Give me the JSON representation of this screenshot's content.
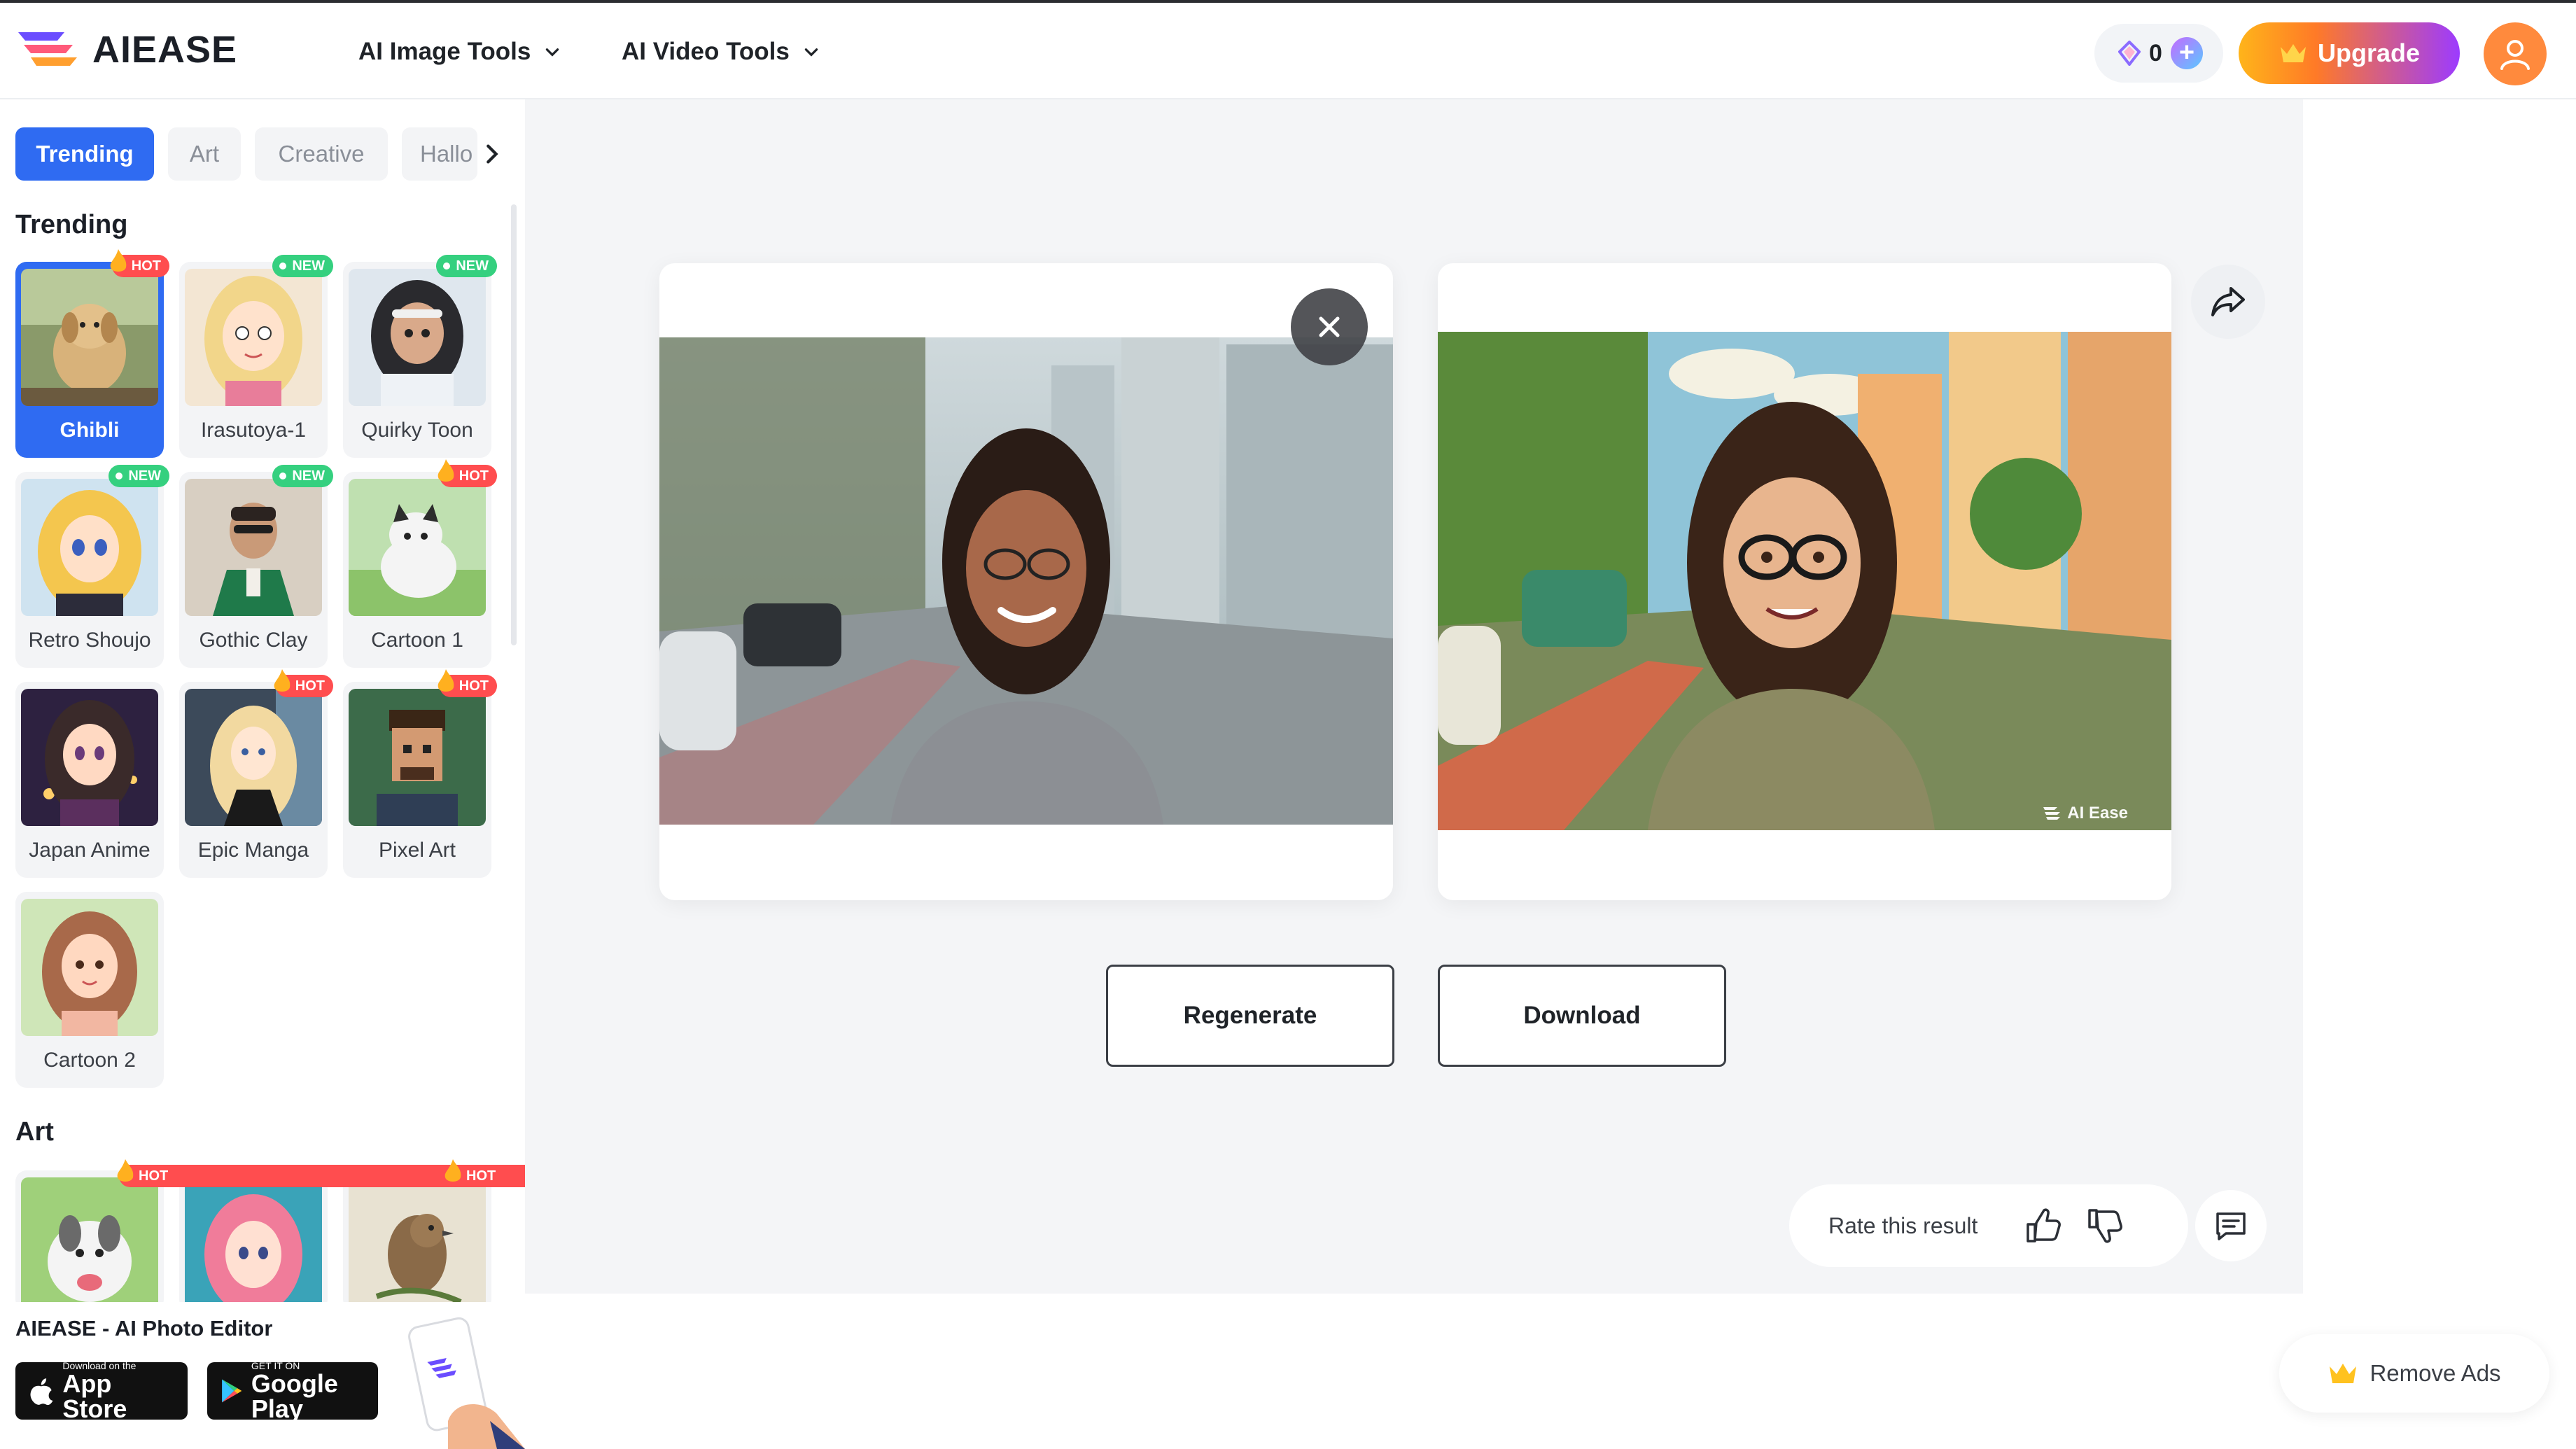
{
  "brand": {
    "name": "AIEASE"
  },
  "nav": {
    "image_tools": "AI Image Tools",
    "video_tools": "AI Video Tools"
  },
  "header": {
    "credits": "0",
    "upgrade": "Upgrade"
  },
  "sidebar": {
    "tabs": [
      "Trending",
      "Art",
      "Creative",
      "Hallo"
    ],
    "active_tab": "Trending",
    "sections": {
      "trending": "Trending",
      "art": "Art"
    },
    "styles": [
      {
        "label": "Ghibli",
        "badge": "HOT"
      },
      {
        "label": "Irasutoya-1",
        "badge": "NEW"
      },
      {
        "label": "Quirky Toon",
        "badge": "NEW"
      },
      {
        "label": "Retro Shoujo",
        "badge": "NEW"
      },
      {
        "label": "Gothic Clay",
        "badge": "NEW"
      },
      {
        "label": "Cartoon 1",
        "badge": "HOT"
      },
      {
        "label": "Japan Anime",
        "badge": ""
      },
      {
        "label": "Epic Manga",
        "badge": "HOT"
      },
      {
        "label": "Pixel Art",
        "badge": "HOT"
      },
      {
        "label": "Cartoon 2",
        "badge": ""
      }
    ],
    "art_badges": [
      "HOT",
      "",
      "HOT"
    ],
    "footer_title": "AIEASE - AI Photo Editor",
    "app_store": {
      "small": "Download on the",
      "big": "App Store"
    },
    "google_play": {
      "small": "GET IT ON",
      "big": "Google Play"
    }
  },
  "result": {
    "watermark": "AI Ease",
    "regenerate": "Regenerate",
    "download": "Download",
    "rate_prompt": "Rate this result"
  },
  "remove_ads": "Remove Ads",
  "colors": {
    "accent_blue": "#2f6bf2",
    "hot_red": "#ff4d4f",
    "new_green": "#35d07f",
    "avatar_orange": "#ff8a3d"
  }
}
